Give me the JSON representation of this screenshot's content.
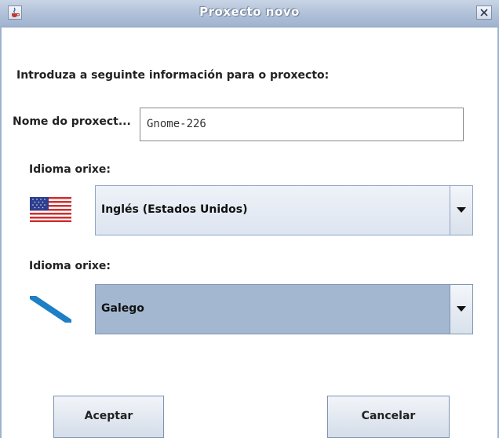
{
  "window": {
    "title": "Proxecto novo",
    "app_icon": "java-cup-icon",
    "close_icon": "close-x-icon"
  },
  "intro_text": "Introduza a seguinte información para o proxecto:",
  "project_name": {
    "label": "Nome do proxect...",
    "value": "Gnome-226"
  },
  "source_language": {
    "label": "Idioma orixe:",
    "flag_icon": "us-flag-icon",
    "selected": "Inglés (Estados Unidos)"
  },
  "target_language": {
    "label": "Idioma orixe:",
    "flag_icon": "galicia-flag-icon",
    "selected": "Galego"
  },
  "buttons": {
    "accept": "Aceptar",
    "cancel": "Cancelar"
  },
  "colors": {
    "titlebar": "#b3c3da",
    "selected_combo": "#a3b8d0"
  }
}
